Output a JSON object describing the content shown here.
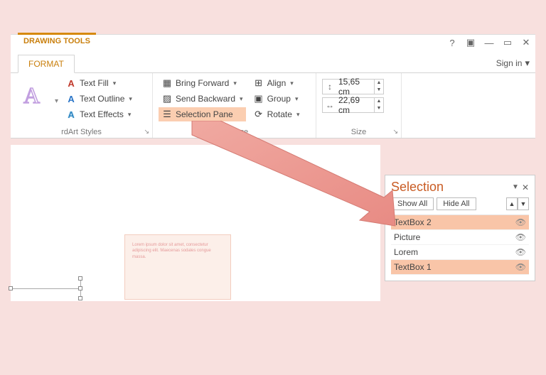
{
  "contextual_title": "DRAWING TOOLS",
  "tab_label": "FORMAT",
  "signin_label": "Sign in",
  "wordart_styles": {
    "label": "rdArt Styles",
    "text_fill": "Text Fill",
    "text_outline": "Text Outline",
    "text_effects": "Text Effects"
  },
  "arrange": {
    "label": "Arrange",
    "bring_forward": "Bring Forward",
    "send_backward": "Send Backward",
    "selection_pane": "Selection Pane",
    "align": "Align",
    "group": "Group",
    "rotate": "Rotate"
  },
  "size": {
    "label": "Size",
    "height": "15,65 cm",
    "width": "22,69 cm"
  },
  "selection": {
    "title": "Selection",
    "show_all": "Show All",
    "hide_all": "Hide All",
    "items": [
      {
        "name": "TextBox 2",
        "selected": true
      },
      {
        "name": "Picture",
        "selected": false
      },
      {
        "name": "Lorem",
        "selected": false
      },
      {
        "name": "TextBox 1",
        "selected": true
      }
    ]
  },
  "placeholder_text": "Lorem ipsum dolor sit amet, consectetur adipiscing elit. Maecenas sodales congue massa."
}
